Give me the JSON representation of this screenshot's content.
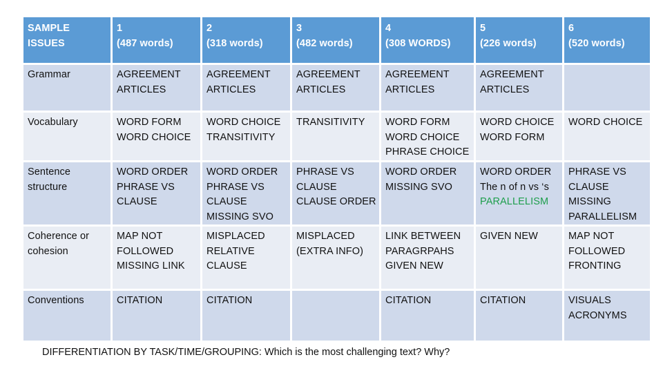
{
  "table": {
    "header": [
      [
        "SAMPLE",
        "ISSUES"
      ],
      [
        "1",
        "(487 words)"
      ],
      [
        "2",
        "(318 words)"
      ],
      [
        "3",
        "(482 words)"
      ],
      [
        "4",
        "(308 WORDS)"
      ],
      [
        "5",
        "(226 words)"
      ],
      [
        "6",
        "(520 words)"
      ]
    ],
    "rows": [
      {
        "label": [
          "Grammar"
        ],
        "cells": [
          [
            "AGREEMENT",
            "ARTICLES"
          ],
          [
            "AGREEMENT",
            "ARTICLES"
          ],
          [
            "AGREEMENT",
            "ARTICLES"
          ],
          [
            "AGREEMENT",
            "ARTICLES"
          ],
          [
            "AGREEMENT",
            "ARTICLES"
          ],
          []
        ]
      },
      {
        "label": [
          "Vocabulary"
        ],
        "cells": [
          [
            "WORD FORM",
            "WORD CHOICE"
          ],
          [
            "WORD CHOICE",
            "TRANSITIVITY"
          ],
          [
            "TRANSITIVITY"
          ],
          [
            "WORD FORM",
            "WORD CHOICE",
            "PHRASE CHOICE"
          ],
          [
            "WORD CHOICE",
            "WORD FORM"
          ],
          [
            "WORD CHOICE"
          ]
        ]
      },
      {
        "label": [
          "Sentence",
          "structure"
        ],
        "cells": [
          [
            "WORD ORDER",
            "PHRASE VS",
            "CLAUSE"
          ],
          [
            "WORD ORDER",
            "PHRASE VS",
            "CLAUSE",
            "MISSING SVO"
          ],
          [
            "PHRASE VS",
            "CLAUSE",
            "CLAUSE ORDER"
          ],
          [
            "WORD ORDER",
            "MISSING SVO"
          ],
          [
            "WORD ORDER",
            "The n of n vs ‘s",
            "PARALLELISM"
          ],
          [
            "PHRASE VS",
            "CLAUSE",
            "MISSING",
            "PARALLELISM"
          ]
        ]
      },
      {
        "label": [
          "Coherence or",
          "cohesion"
        ],
        "cells": [
          [
            "MAP NOT",
            "FOLLOWED",
            "MISSING LINK"
          ],
          [
            "MISPLACED",
            "RELATIVE",
            "CLAUSE"
          ],
          [
            "MISPLACED",
            "(EXTRA INFO)"
          ],
          [
            "LINK BETWEEN",
            "PARAGRPAHS",
            "GIVEN NEW"
          ],
          [
            "GIVEN NEW"
          ],
          [
            "MAP NOT",
            "FOLLOWED",
            "FRONTING"
          ]
        ]
      },
      {
        "label": [
          "Conventions"
        ],
        "cells": [
          [
            "CITATION"
          ],
          [
            "CITATION"
          ],
          [],
          [
            "CITATION"
          ],
          [
            "CITATION"
          ],
          [
            "VISUALS",
            "ACRONYMS"
          ]
        ]
      }
    ],
    "highlight": {
      "row": 2,
      "col": 4,
      "line": 2,
      "color": "#1e9e4c"
    }
  },
  "caption": "DIFFERENTIATION BY TASK/TIME/GROUPING: Which is the most challenging text? Why?"
}
